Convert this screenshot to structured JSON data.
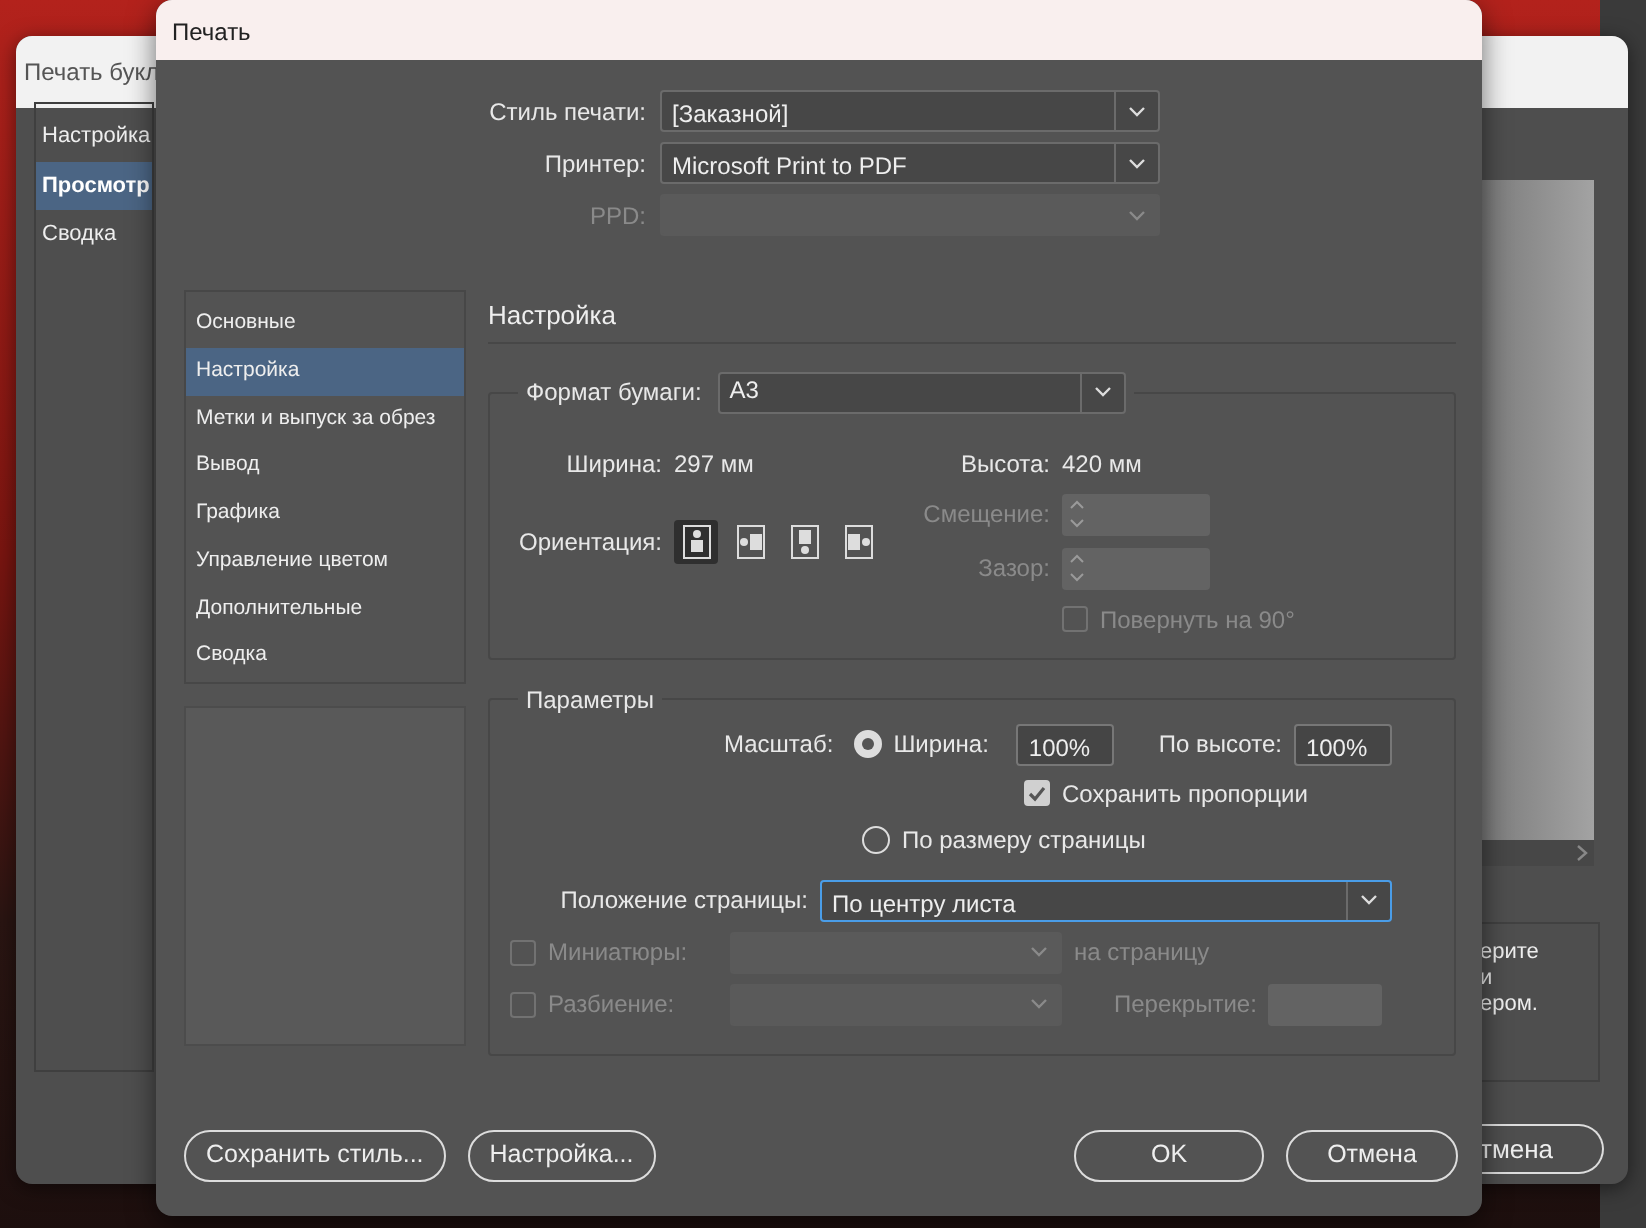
{
  "back_window": {
    "title": "Печать букл",
    "nav": [
      {
        "label": "Настройка",
        "selected": false
      },
      {
        "label": "Просмотр",
        "selected": true
      },
      {
        "label": "Сводка",
        "selected": false
      }
    ],
    "note_lines": [
      "ерите",
      "и",
      "ером."
    ],
    "cancel_button": "тмена"
  },
  "dialog": {
    "title": "Печать",
    "top_fields": [
      {
        "label": "Стиль печати:",
        "value": "[Заказной]",
        "disabled": false
      },
      {
        "label": "Принтер:",
        "value": "Microsoft Print to PDF",
        "disabled": false
      },
      {
        "label": "PPD:",
        "disabled": true
      }
    ],
    "nav": [
      {
        "label": "Основные",
        "selected": false
      },
      {
        "label": "Настройка",
        "selected": true
      },
      {
        "label": "Метки и выпуск за обрез",
        "selected": false
      },
      {
        "label": "Вывод",
        "selected": false
      },
      {
        "label": "Графика",
        "selected": false
      },
      {
        "label": "Управление цветом",
        "selected": false
      },
      {
        "label": "Дополнительные",
        "selected": false
      },
      {
        "label": "Сводка",
        "selected": false
      }
    ],
    "section_title": "Настройка",
    "paper": {
      "label": "Формат бумаги:",
      "value": "A3",
      "width_label": "Ширина:",
      "width": "297 мм",
      "height_label": "Высота:",
      "height": "420 мм",
      "orientation_label": "Ориентация:",
      "orientations": [
        {
          "kind": "portrait",
          "selected": true
        },
        {
          "kind": "landscape",
          "selected": false
        },
        {
          "kind": "portrait-flipped",
          "selected": false
        },
        {
          "kind": "landscape-flipped",
          "selected": false
        }
      ],
      "offset_label": "Смещение:",
      "gap_label": "Зазор:",
      "rotate": {
        "label": "Повернуть на 90°",
        "checked": false,
        "disabled": true
      }
    },
    "options": {
      "title": "Параметры",
      "scale_label": "Масштаб:",
      "scale_modes": [
        {
          "label": "Ширина:",
          "selected": true
        },
        {
          "label": "По размеру страницы",
          "selected": false
        }
      ],
      "width_value": "100%",
      "height_label": "По высоте:",
      "height_value": "100%",
      "keep_proportions": {
        "label": "Сохранить пропорции",
        "checked": true
      },
      "position_label": "Положение страницы:",
      "position_value": "По центру листа",
      "thumbnails": {
        "label": "Миниатюры:",
        "checked": false,
        "disabled": true,
        "suffix": "на страницу"
      },
      "tiling": {
        "label": "Разбиение:",
        "checked": false,
        "disabled": true,
        "overlap_label": "Перекрытие:"
      }
    },
    "buttons_left": [
      "Сохранить стиль...",
      "Настройка..."
    ],
    "buttons_right": [
      "OK",
      "Отмена"
    ]
  }
}
